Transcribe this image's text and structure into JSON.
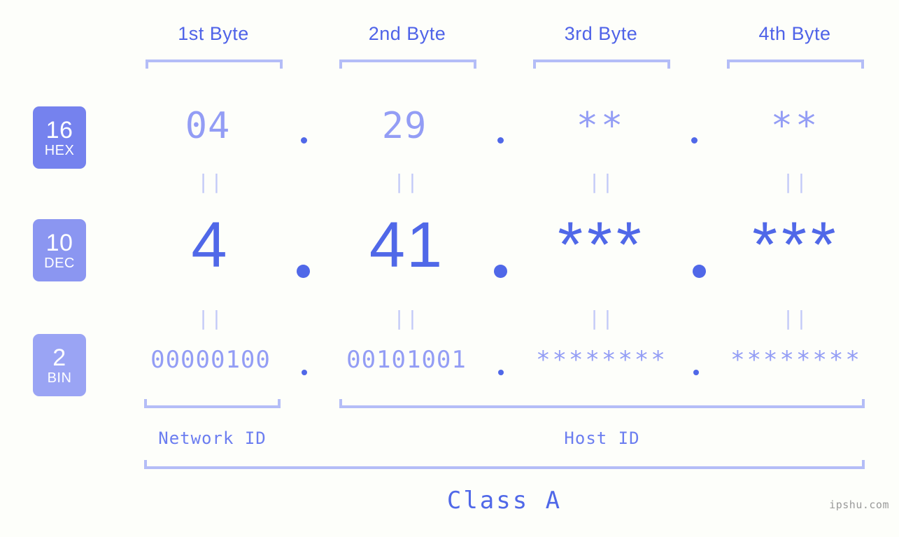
{
  "headers": {
    "bytes": [
      {
        "label": "1st Byte"
      },
      {
        "label": "2nd Byte"
      },
      {
        "label": "3rd Byte"
      },
      {
        "label": "4th Byte"
      }
    ]
  },
  "bases": [
    {
      "number": "16",
      "name": "HEX",
      "color": "#7582ee"
    },
    {
      "number": "10",
      "name": "DEC",
      "color": "#8b96f1"
    },
    {
      "number": "2",
      "name": "BIN",
      "color": "#9aa4f4"
    }
  ],
  "rows": {
    "hex": {
      "base_number": "16",
      "base_name": "HEX",
      "values": [
        "04",
        "29",
        "**",
        "**"
      ],
      "masked": [
        false,
        false,
        true,
        true
      ],
      "separator": "."
    },
    "dec": {
      "base_number": "10",
      "base_name": "DEC",
      "values": [
        "4",
        "41",
        "***",
        "***"
      ],
      "masked": [
        false,
        false,
        true,
        true
      ],
      "separator": "."
    },
    "bin": {
      "base_number": "2",
      "base_name": "BIN",
      "values": [
        "00000100",
        "00101001",
        "********",
        "********"
      ],
      "masked": [
        false,
        false,
        true,
        true
      ],
      "separator": "."
    }
  },
  "connectors": {
    "mark": "||"
  },
  "segments": {
    "network_id": "Network ID",
    "host_id": "Host ID"
  },
  "class": {
    "label": "Class A"
  },
  "watermark": {
    "text": "ipshu.com"
  },
  "colors": {
    "background": "#fdfefa",
    "accent_strong": "#5068e8",
    "accent_mid": "#6b7df0",
    "accent_light": "#939df5",
    "bracket": "#b4bdf7",
    "connector": "#c3caf8",
    "watermark": "#9a9a9a"
  },
  "chart_data": {
    "type": "table",
    "title": "IPv4 address representation by byte and numeral base",
    "columns": [
      "1st Byte",
      "2nd Byte",
      "3rd Byte",
      "4th Byte"
    ],
    "rows": [
      {
        "base": "16 HEX",
        "cells": [
          "04",
          "29",
          "**",
          "**"
        ]
      },
      {
        "base": "10 DEC",
        "cells": [
          "4",
          "41",
          "***",
          "***"
        ]
      },
      {
        "base": "2 BIN",
        "cells": [
          "00000100",
          "00101001",
          "********",
          "********"
        ]
      }
    ],
    "segments": [
      {
        "name": "Network ID",
        "bytes": [
          1
        ]
      },
      {
        "name": "Host ID",
        "bytes": [
          2,
          3,
          4
        ]
      }
    ],
    "address_class": "Class A"
  }
}
